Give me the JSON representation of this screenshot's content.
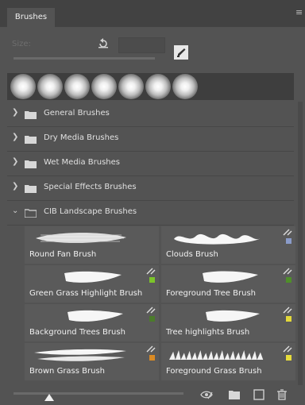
{
  "panel": {
    "tab_label": "Brushes",
    "size_label": "Size:",
    "size_value": "",
    "preset_count": 7
  },
  "groups": [
    {
      "label": "General Brushes",
      "expanded": false
    },
    {
      "label": "Dry Media Brushes",
      "expanded": false
    },
    {
      "label": "Wet Media Brushes",
      "expanded": false
    },
    {
      "label": "Special Effects Brushes",
      "expanded": false
    },
    {
      "label": "CIB Landscape Brushes",
      "expanded": true
    }
  ],
  "brushes": [
    {
      "name": "Round Fan Brush",
      "swatch": null
    },
    {
      "name": "Clouds Brush",
      "swatch": "#8a9bc9"
    },
    {
      "name": "Green Grass Highlight Brush",
      "swatch": "#7cc42a"
    },
    {
      "name": "Foreground Tree Brush",
      "swatch": "#4f8f2a"
    },
    {
      "name": "Background Trees Brush",
      "swatch": "#4b7b2b"
    },
    {
      "name": "Tree highlights Brush",
      "swatch": "#e2d83a"
    },
    {
      "name": "Brown Grass Brush",
      "swatch": "#d98a24"
    },
    {
      "name": "Foreground Grass Brush",
      "swatch": "#e6dc3b"
    }
  ],
  "colors": {
    "panel_bg": "#535353",
    "titlebar_bg": "#424242",
    "cell_bg": "#5a5a5a"
  },
  "icons": {
    "menu": "hamburger-menu-icon",
    "reset": "reset-size-icon",
    "brush_settings": "brush-settings-icon",
    "folder": "folder-icon",
    "eye": "eye-icon",
    "new_group": "new-group-icon",
    "new_brush": "new-brush-icon",
    "trash": "trash-icon"
  }
}
